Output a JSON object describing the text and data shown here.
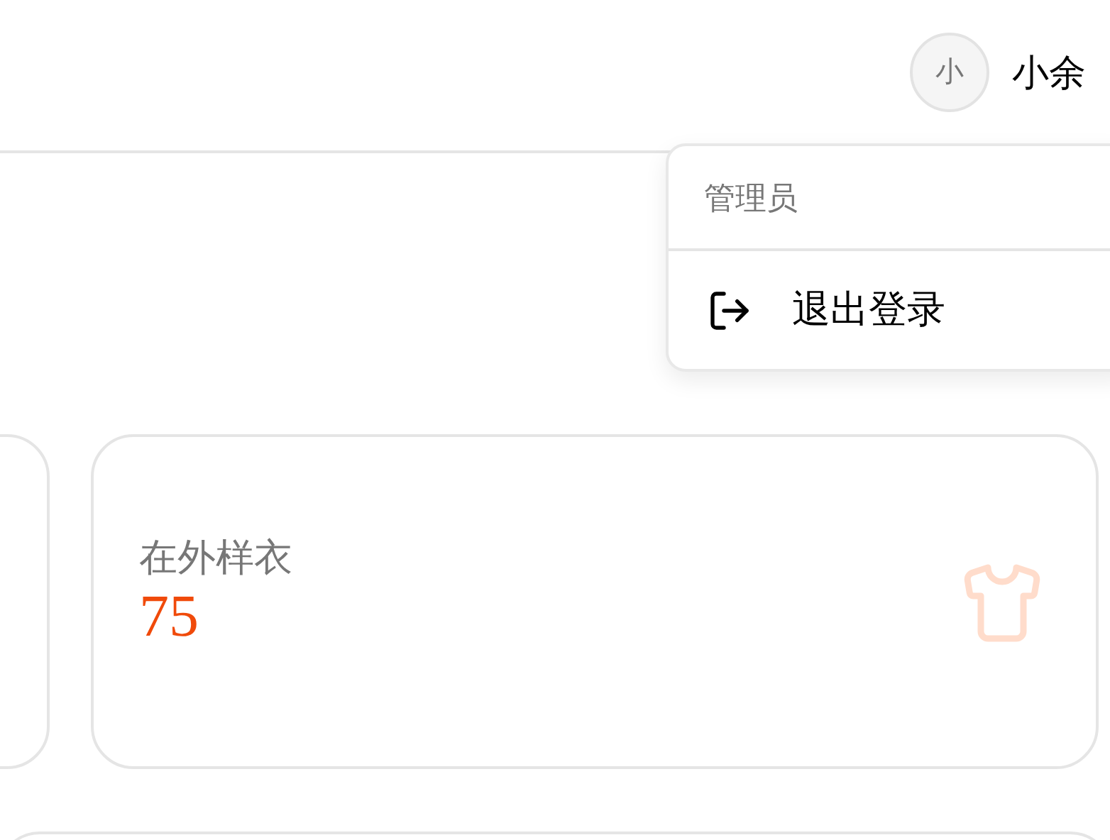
{
  "header": {
    "user": {
      "avatar_text": "小",
      "name": "小余"
    }
  },
  "user_menu": {
    "role": "管理员",
    "items": [
      {
        "label": "退出登录"
      }
    ]
  },
  "stat_cards": [
    {
      "label": "在外样衣",
      "value": "75"
    }
  ]
}
